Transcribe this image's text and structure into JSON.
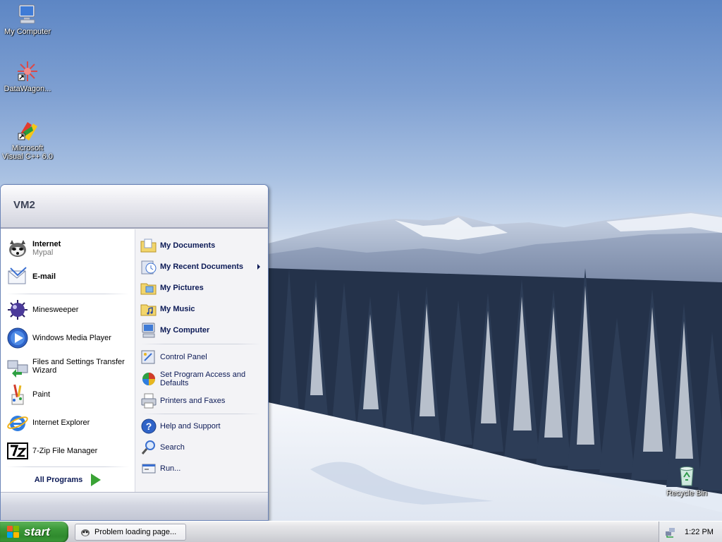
{
  "desktop": {
    "icons": [
      {
        "label": "My Computer",
        "icon": "my-computer-icon"
      },
      {
        "label": "DataWagon...",
        "icon": "datawagon-icon"
      },
      {
        "label": "Microsoft Visual C++ 6.0",
        "icon": "visual-cpp-icon"
      },
      {
        "label": "Recycle Bin",
        "icon": "recycle-bin-icon"
      }
    ]
  },
  "start_menu": {
    "user_name": "VM2",
    "pinned": [
      {
        "title": "Internet",
        "subtitle": "Mypal",
        "icon": "mypal-browser-icon"
      },
      {
        "title": "E-mail",
        "icon": "email-icon"
      }
    ],
    "recent": [
      {
        "label": "Minesweeper",
        "icon": "minesweeper-icon"
      },
      {
        "label": "Windows Media Player",
        "icon": "media-player-icon"
      },
      {
        "label": "Files and Settings Transfer Wizard",
        "icon": "transfer-wizard-icon"
      },
      {
        "label": "Paint",
        "icon": "paint-icon"
      },
      {
        "label": "Internet Explorer",
        "icon": "internet-explorer-icon"
      },
      {
        "label": "7-Zip File Manager",
        "icon": "7zip-icon"
      }
    ],
    "all_programs_label": "All Programs",
    "places": [
      {
        "label": "My Documents",
        "icon": "folder-documents-icon"
      },
      {
        "label": "My Recent Documents",
        "icon": "recent-documents-icon"
      },
      {
        "label": "My Pictures",
        "icon": "folder-pictures-icon"
      },
      {
        "label": "My Music",
        "icon": "folder-music-icon"
      },
      {
        "label": "My Computer",
        "icon": "my-computer-icon"
      }
    ],
    "system": [
      {
        "label": "Control Panel",
        "icon": "control-panel-icon"
      },
      {
        "label": "Set Program Access and Defaults",
        "icon": "program-defaults-icon"
      },
      {
        "label": "Printers and Faxes",
        "icon": "printer-icon"
      }
    ],
    "help": [
      {
        "label": "Help and Support",
        "icon": "help-icon"
      },
      {
        "label": "Search",
        "icon": "search-icon"
      },
      {
        "label": "Run...",
        "icon": "run-icon"
      }
    ]
  },
  "taskbar": {
    "start_label": "start",
    "tasks": [
      {
        "label": "Problem loading page...",
        "icon": "mypal-browser-icon"
      }
    ],
    "clock": "1:22 PM"
  },
  "colors": {
    "start_green": "#3c9a39",
    "menu_text": "#0c1a56",
    "wallpaper_sky": "#7fa0d2"
  }
}
